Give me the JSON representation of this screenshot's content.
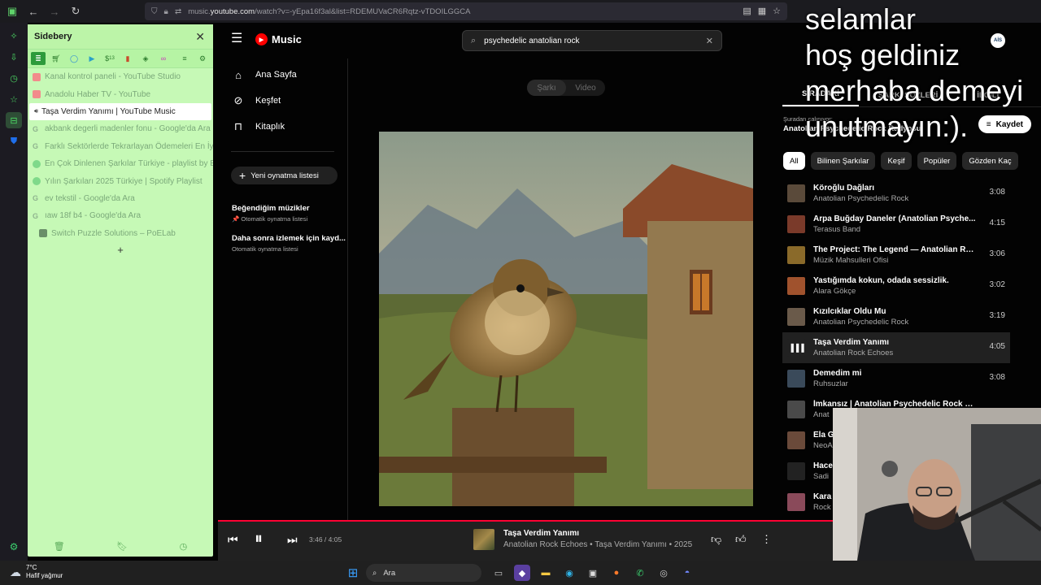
{
  "browser": {
    "url_prefix": "music.",
    "url_host": "youtube.com",
    "url_path": "/watch?v=-yEpa16f3al&list=RDEMUVaCR6Rqtz-vTDOILGGCA"
  },
  "sidebery": {
    "title": "Sidebery",
    "panel_counts": [
      "",
      "",
      "",
      "",
      "13",
      "",
      "",
      "",
      ""
    ],
    "tabs": [
      {
        "label": "Kanal kontrol paneli - YouTube Studio",
        "fav": "yt",
        "active": false
      },
      {
        "label": "Anadolu Haber TV - YouTube",
        "fav": "yt",
        "active": false
      },
      {
        "label": "Taşa Verdim Yanımı | YouTube Music",
        "fav": "ytm",
        "active": true
      },
      {
        "label": "akbank degerli madenler fonu - Google'da Ara",
        "fav": "g",
        "active": false
      },
      {
        "label": "Farklı Sektörlerde Tekrarlayan Ödemeleri En İyi",
        "fav": "g",
        "active": false
      },
      {
        "label": "En Çok Dinlenen Şarkılar Türkiye - playlist by E",
        "fav": "sp",
        "active": false
      },
      {
        "label": "Yılın Şarkıları 2025 Türkiye | Spotify Playlist",
        "fav": "sp",
        "active": false
      },
      {
        "label": "ev tekstil - Google'da Ara",
        "fav": "g",
        "active": false
      },
      {
        "label": "ıaw 18f b4 - Google'da Ara",
        "fav": "g",
        "active": false
      },
      {
        "label": "Switch Puzzle Solutions – PoELab",
        "fav": "pz",
        "active": false
      }
    ],
    "add_label": "+"
  },
  "ytm": {
    "logo_text": "Music",
    "search_value": "psychedelic anatolian rock",
    "account_initials": "AİS",
    "nav": [
      {
        "label": "Ana Sayfa",
        "icon": "home-icon"
      },
      {
        "label": "Keşfet",
        "icon": "explore-icon"
      },
      {
        "label": "Kitaplık",
        "icon": "library-icon"
      }
    ],
    "new_playlist": "Yeni oynatma listesi",
    "playlists": [
      {
        "title": "Beğendiğim müzikler",
        "sub": "📌 Otomatik oynatma listesi"
      },
      {
        "title": "Daha sonra izlemek için kayd...",
        "sub": "Otomatik oynatma listesi"
      }
    ],
    "toggle": {
      "song": "Şarkı",
      "video": "Video"
    },
    "queue": {
      "tabs": [
        "SIRADAKİ",
        "ŞARKI SÖZLERİ",
        "İLGİLİ"
      ],
      "from_label": "Şuradan çalınıyor:",
      "from_value": "Anatolian Psychedelic Rock Radyosu",
      "save_label": "Kaydet",
      "chips": [
        "All",
        "Bilinen Şarkılar",
        "Keşif",
        "Popüler",
        "Gözden Kaç"
      ],
      "items": [
        {
          "title": "Köroğlu Dağları",
          "artist": "Anatolian Psychedelic Rock",
          "dur": "3:08",
          "color": "#5a4a3a"
        },
        {
          "title": "Arpa Buğday Daneler (Anatolian Psyche...",
          "artist": "Terasus Band",
          "dur": "4:15",
          "color": "#7a3a2a"
        },
        {
          "title": "The Project: The Legend — Anatolian Ro...",
          "artist": "Müzik Mahsulleri Ofisi",
          "dur": "3:06",
          "color": "#8a6a2a"
        },
        {
          "title": "Yastığımda kokun, odada sessizlik.",
          "artist": "Alara Gökçe",
          "dur": "3:02",
          "color": "#a0522d"
        },
        {
          "title": "Kızılcıklar Oldu Mu",
          "artist": "Anatolian Psychedelic Rock",
          "dur": "3:19",
          "color": "#6a5a4a"
        },
        {
          "title": "Taşa Verdim Yanımı",
          "artist": "Anatolian Rock Echoes",
          "dur": "4:05",
          "color": "#212121",
          "active": true
        },
        {
          "title": "Demedim mi",
          "artist": "Ruhsuzlar",
          "dur": "3:08",
          "color": "#3a4a5a"
        },
        {
          "title": "İmkansız | Anatolian Psychedelic Rock C...",
          "artist": "Anat",
          "dur": "",
          "color": "#4a4a4a"
        },
        {
          "title": "Ela G",
          "artist": "NeoA",
          "dur": "",
          "color": "#6a4a3a"
        },
        {
          "title": "Hace",
          "artist": "Sadi",
          "dur": "",
          "color": "#222"
        },
        {
          "title": "Kara",
          "artist": "Rock",
          "dur": "",
          "color": "#8a4a5a"
        }
      ]
    },
    "player": {
      "time": "3:46 / 4:05",
      "progress": 0.92,
      "title": "Taşa Verdim Yanımı",
      "subtitle": "Anatolian Rock Echoes • Taşa Verdim Yanımı • 2025"
    }
  },
  "overlay_lines": [
    "selamlar",
    "hoş geldiniz",
    "merhaba demeyi",
    "unutmayın:)."
  ],
  "taskbar": {
    "temp": "7°C",
    "weather": "Hafif yağmur",
    "search_label": "Ara"
  }
}
